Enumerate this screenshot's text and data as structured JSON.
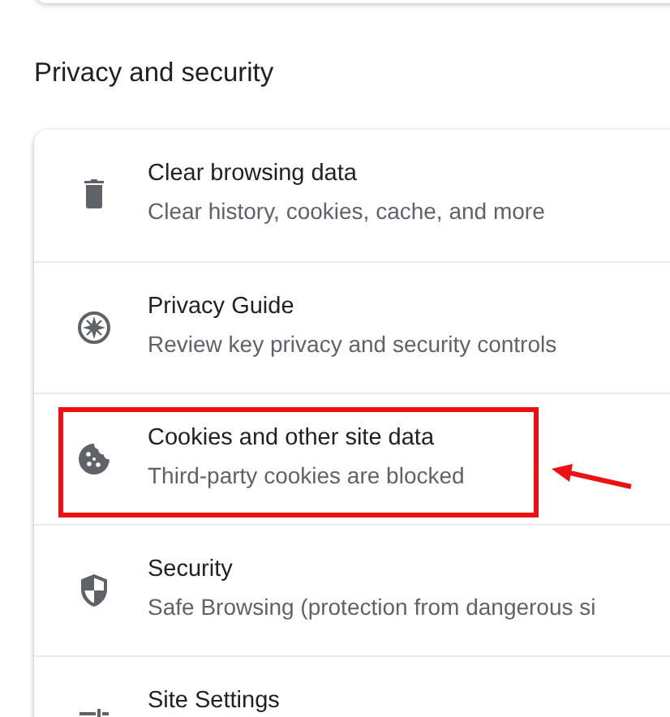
{
  "section": {
    "title": "Privacy and security"
  },
  "items": [
    {
      "kind": "trash",
      "title": "Clear browsing data",
      "subtitle": "Clear history, cookies, cache, and more",
      "highlighted": false
    },
    {
      "kind": "compass",
      "title": "Privacy Guide",
      "subtitle": "Review key privacy and security controls",
      "highlighted": false
    },
    {
      "kind": "cookie",
      "title": "Cookies and other site data",
      "subtitle": "Third-party cookies are blocked",
      "highlighted": true
    },
    {
      "kind": "shield",
      "title": "Security",
      "subtitle": "Safe Browsing (protection from dangerous si",
      "highlighted": false
    },
    {
      "kind": "sliders",
      "title": "Site Settings",
      "highlighted": false
    }
  ]
}
